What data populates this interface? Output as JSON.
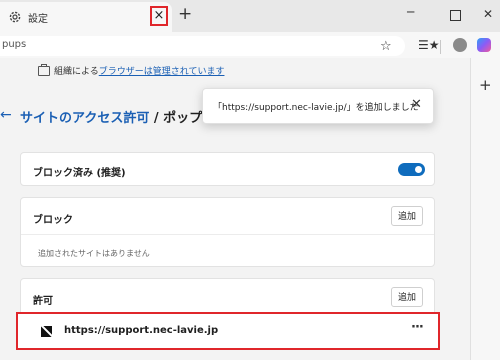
{
  "tab": {
    "title": "設定",
    "close": "×",
    "new_tab": "+"
  },
  "window_controls": {
    "minimize": "─",
    "close": "✕"
  },
  "address_bar": {
    "url_fragment": "pups",
    "star": "☆",
    "favorites": "☰★"
  },
  "managed_notice": {
    "prefix": "組織による",
    "link": "ブラウザーは管理されています"
  },
  "side_panel": {
    "add": "+"
  },
  "page": {
    "back": "←",
    "breadcrumb": "サイトのアクセス許可",
    "separator": " / ",
    "title": "ポップアップとリダイレクト"
  },
  "toggle_section": {
    "label": "ブロック済み (推奨)",
    "enabled": true
  },
  "block_section": {
    "label": "ブロック",
    "add_button": "追加",
    "empty_text": "追加されたサイトはありません"
  },
  "allow_section": {
    "label": "許可",
    "add_button": "追加",
    "sites": [
      {
        "url": "https://support.nec-lavie.jp",
        "menu": "···"
      }
    ]
  },
  "toast": {
    "message": "「https://support.nec-lavie.jp/」を追加しました",
    "close": "✕"
  },
  "colors": {
    "accent": "#0f6cbd",
    "link": "#1a5fb4",
    "highlight": "#e0262b"
  }
}
